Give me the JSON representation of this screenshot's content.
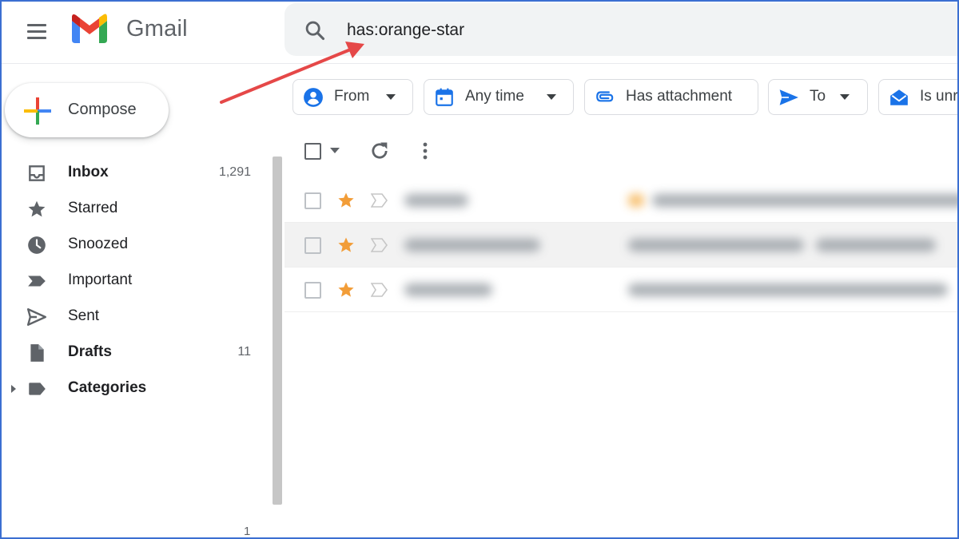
{
  "header": {
    "app_name": "Gmail",
    "search_value": "has:orange-star"
  },
  "compose": {
    "label": "Compose"
  },
  "sidebar": {
    "items": [
      {
        "label": "Inbox",
        "count": "1,291",
        "bold": true,
        "icon": "inbox-icon"
      },
      {
        "label": "Starred",
        "count": "",
        "bold": false,
        "icon": "star-icon"
      },
      {
        "label": "Snoozed",
        "count": "",
        "bold": false,
        "icon": "clock-icon"
      },
      {
        "label": "Important",
        "count": "",
        "bold": false,
        "icon": "important-icon"
      },
      {
        "label": "Sent",
        "count": "",
        "bold": false,
        "icon": "send-icon"
      },
      {
        "label": "Drafts",
        "count": "11",
        "bold": true,
        "icon": "draft-icon"
      },
      {
        "label": "Categories",
        "count": "",
        "bold": true,
        "icon": "label-icon"
      }
    ],
    "bottom_number": "1"
  },
  "chips": [
    {
      "label": "From",
      "icon": "person-icon"
    },
    {
      "label": "Any time",
      "icon": "calendar-icon"
    },
    {
      "label": "Has attachment",
      "icon": "paperclip-icon"
    },
    {
      "label": "To",
      "icon": "send-icon"
    },
    {
      "label": "Is unr",
      "icon": "mark-read-icon"
    }
  ],
  "emails": [
    {
      "starred": true,
      "star_color": "#f29d38"
    },
    {
      "starred": true,
      "star_color": "#f29d38"
    },
    {
      "starred": true,
      "star_color": "#f29d38"
    }
  ],
  "colors": {
    "accent_blue": "#1a73e8",
    "star_orange": "#f29d38",
    "annotation_red": "#e54848",
    "frame_blue": "#3b6fd1"
  }
}
